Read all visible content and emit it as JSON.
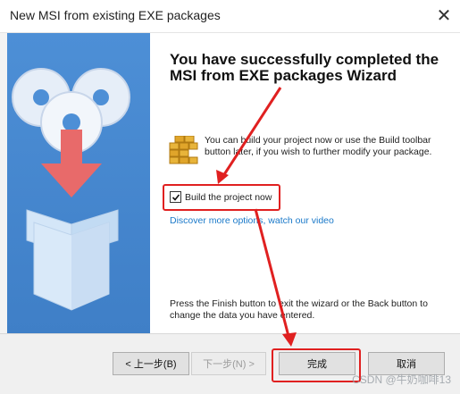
{
  "window": {
    "title": "New MSI from existing EXE packages",
    "close_glyph": "✕"
  },
  "content": {
    "heading": "You have successfully completed the MSI from EXE packages Wizard",
    "info_text": "You can build your project now or use the Build toolbar button later, if you wish to further modify your package.",
    "build_checkbox": {
      "label": "Build the project now",
      "checked": true
    },
    "discover_link": "Discover more options, watch our video",
    "finish_text": "Press the Finish button to exit the wizard or the Back button to change the data you have entered."
  },
  "buttons": {
    "back": "< 上一步(B)",
    "next": "下一步(N) >",
    "finish": "完成",
    "cancel": "取消"
  },
  "watermark": "CSDN @牛奶咖啡13",
  "colors": {
    "panel_blue": "#4d8fd6",
    "annotation_red": "#e02020",
    "link_blue": "#1a79c9"
  }
}
